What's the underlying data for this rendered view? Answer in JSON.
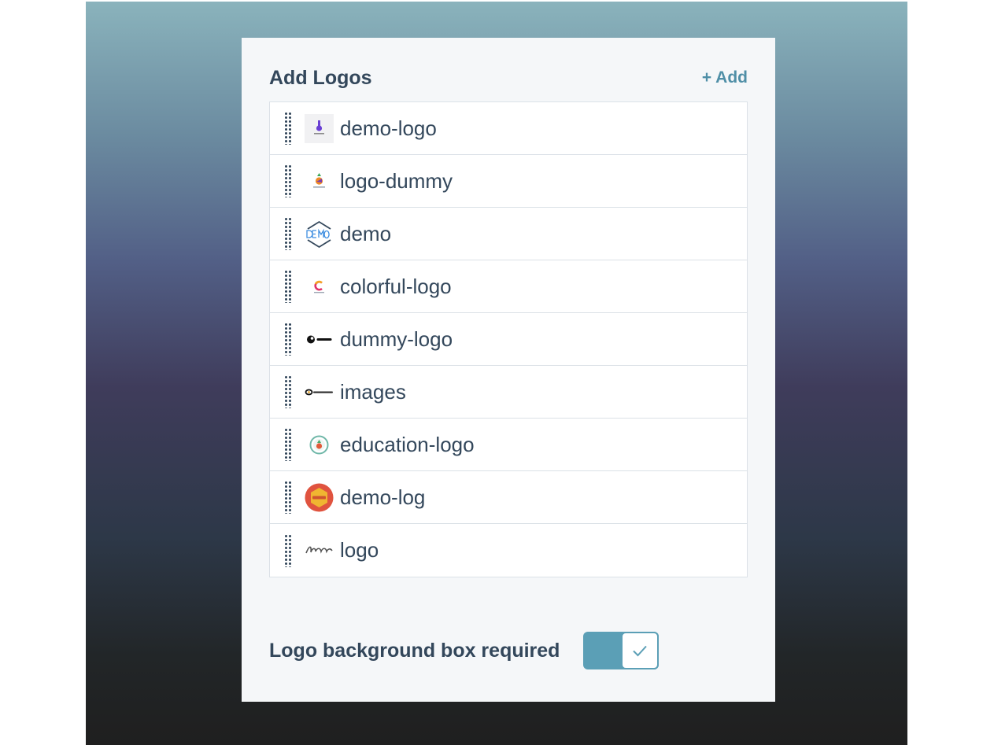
{
  "panel": {
    "title": "Add Logos",
    "add_label": "+ Add"
  },
  "logos": [
    {
      "label": "demo-logo",
      "icon": "purple-figure-logo-icon"
    },
    {
      "label": "logo-dummy",
      "icon": "colorful-fruit-logo-icon"
    },
    {
      "label": "demo",
      "icon": "demo-hexagon-logo-icon"
    },
    {
      "label": "colorful-logo",
      "icon": "colorful-c-logo-icon"
    },
    {
      "label": "dummy-logo",
      "icon": "black-circle-logo-icon"
    },
    {
      "label": "images",
      "icon": "logoipsum-logo-icon"
    },
    {
      "label": "education-logo",
      "icon": "round-education-logo-icon"
    },
    {
      "label": "demo-log",
      "icon": "demo-badge-logo-icon"
    },
    {
      "label": "logo",
      "icon": "script-logo-icon"
    }
  ],
  "toggle": {
    "label": "Logo background box required",
    "checked": true
  },
  "colors": {
    "accent": "#5b9fb6",
    "text": "#33475b",
    "panel_bg": "#f5f7f9"
  }
}
